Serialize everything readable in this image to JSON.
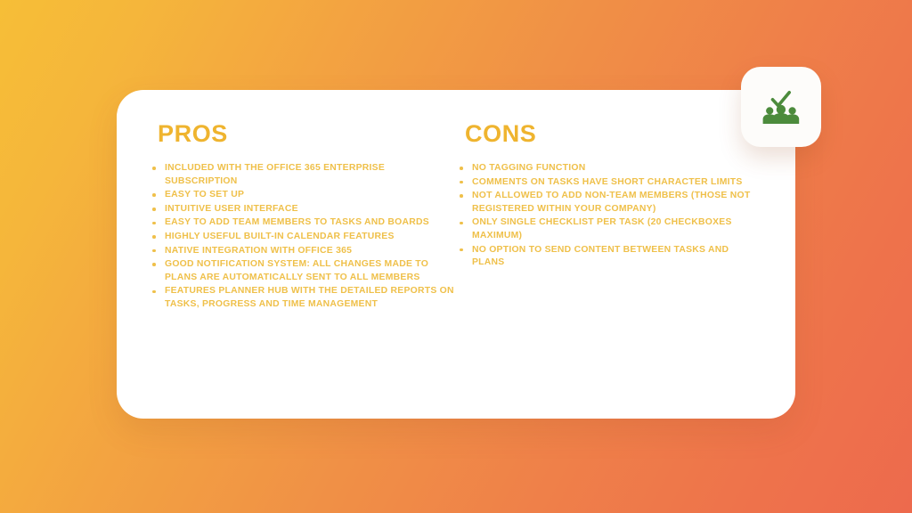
{
  "slide": {
    "background": {
      "from": "#F6BE37",
      "to": "#ED6A4D"
    },
    "card_background": "#FFFFFF",
    "accent_heading_color": "#EFB42F",
    "accent_list_color": "#EFC04A",
    "icon_color": "#4C8B3C"
  },
  "badge": {
    "icon": "team-approved-icon",
    "icon_parts": [
      "checkmark",
      "group-of-people"
    ]
  },
  "pros": {
    "title": "PROS",
    "items": [
      "INCLUDED WITH THE OFFICE 365 ENTERPRISE SUBSCRIPTION",
      "EASY TO SET UP",
      "INTUITIVE USER INTERFACE",
      "EASY TO ADD TEAM MEMBERS TO TASKS AND BOARDS",
      "HIGHLY USEFUL BUILT-IN CALENDAR FEATURES",
      "NATIVE INTEGRATION WITH OFFICE 365",
      "GOOD NOTIFICATION SYSTEM: ALL CHANGES MADE TO PLANS ARE AUTOMATICALLY SENT TO ALL MEMBERS",
      "FEATURES PLANNER HUB WITH THE DETAILED REPORTS ON TASKS, PROGRESS AND TIME MANAGEMENT"
    ]
  },
  "cons": {
    "title": "CONS",
    "items": [
      "NO TAGGING FUNCTION",
      "COMMENTS ON TASKS HAVE SHORT CHARACTER LIMITS",
      "NOT ALLOWED TO ADD NON-TEAM MEMBERS (THOSE NOT REGISTERED WITHIN YOUR COMPANY)",
      "ONLY SINGLE CHECKLIST PER TASK (20 CHECKBOXES MAXIMUM)",
      "NO OPTION TO SEND CONTENT BETWEEN TASKS AND PLANS"
    ]
  }
}
